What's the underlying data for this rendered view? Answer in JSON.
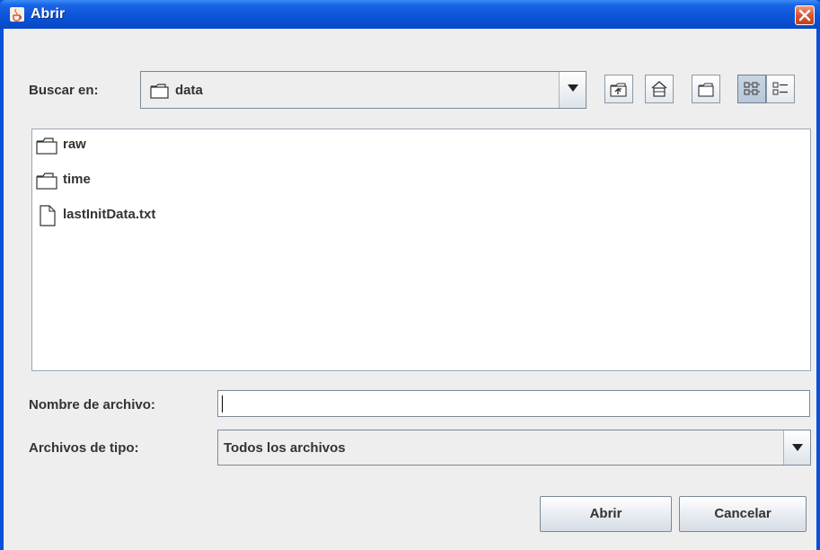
{
  "window": {
    "title": "Abrir",
    "icon": "java-cup-icon",
    "close_icon": "close-icon"
  },
  "toolbar": {
    "look_in_label": "Buscar en:",
    "look_in_value": "data",
    "buttons": [
      {
        "name": "up-one-level-icon"
      },
      {
        "name": "home-icon"
      },
      {
        "name": "new-folder-icon"
      },
      {
        "name": "list-view-icon",
        "selected": true
      },
      {
        "name": "details-view-icon",
        "selected": false
      }
    ]
  },
  "file_list": {
    "items": [
      {
        "label": "raw",
        "type": "folder"
      },
      {
        "label": "time",
        "type": "folder"
      },
      {
        "label": "lastInitData.txt",
        "type": "file"
      }
    ]
  },
  "form": {
    "file_name_label": "Nombre de archivo:",
    "file_name_value": "",
    "file_type_label": "Archivos de tipo:",
    "file_type_value": "Todos los archivos"
  },
  "buttons": {
    "open_label": "Abrir",
    "cancel_label": "Cancelar"
  },
  "colors": {
    "titlebar": "#0a52d6",
    "close_button": "#d9542e",
    "dialog_background": "#eeeeee"
  }
}
